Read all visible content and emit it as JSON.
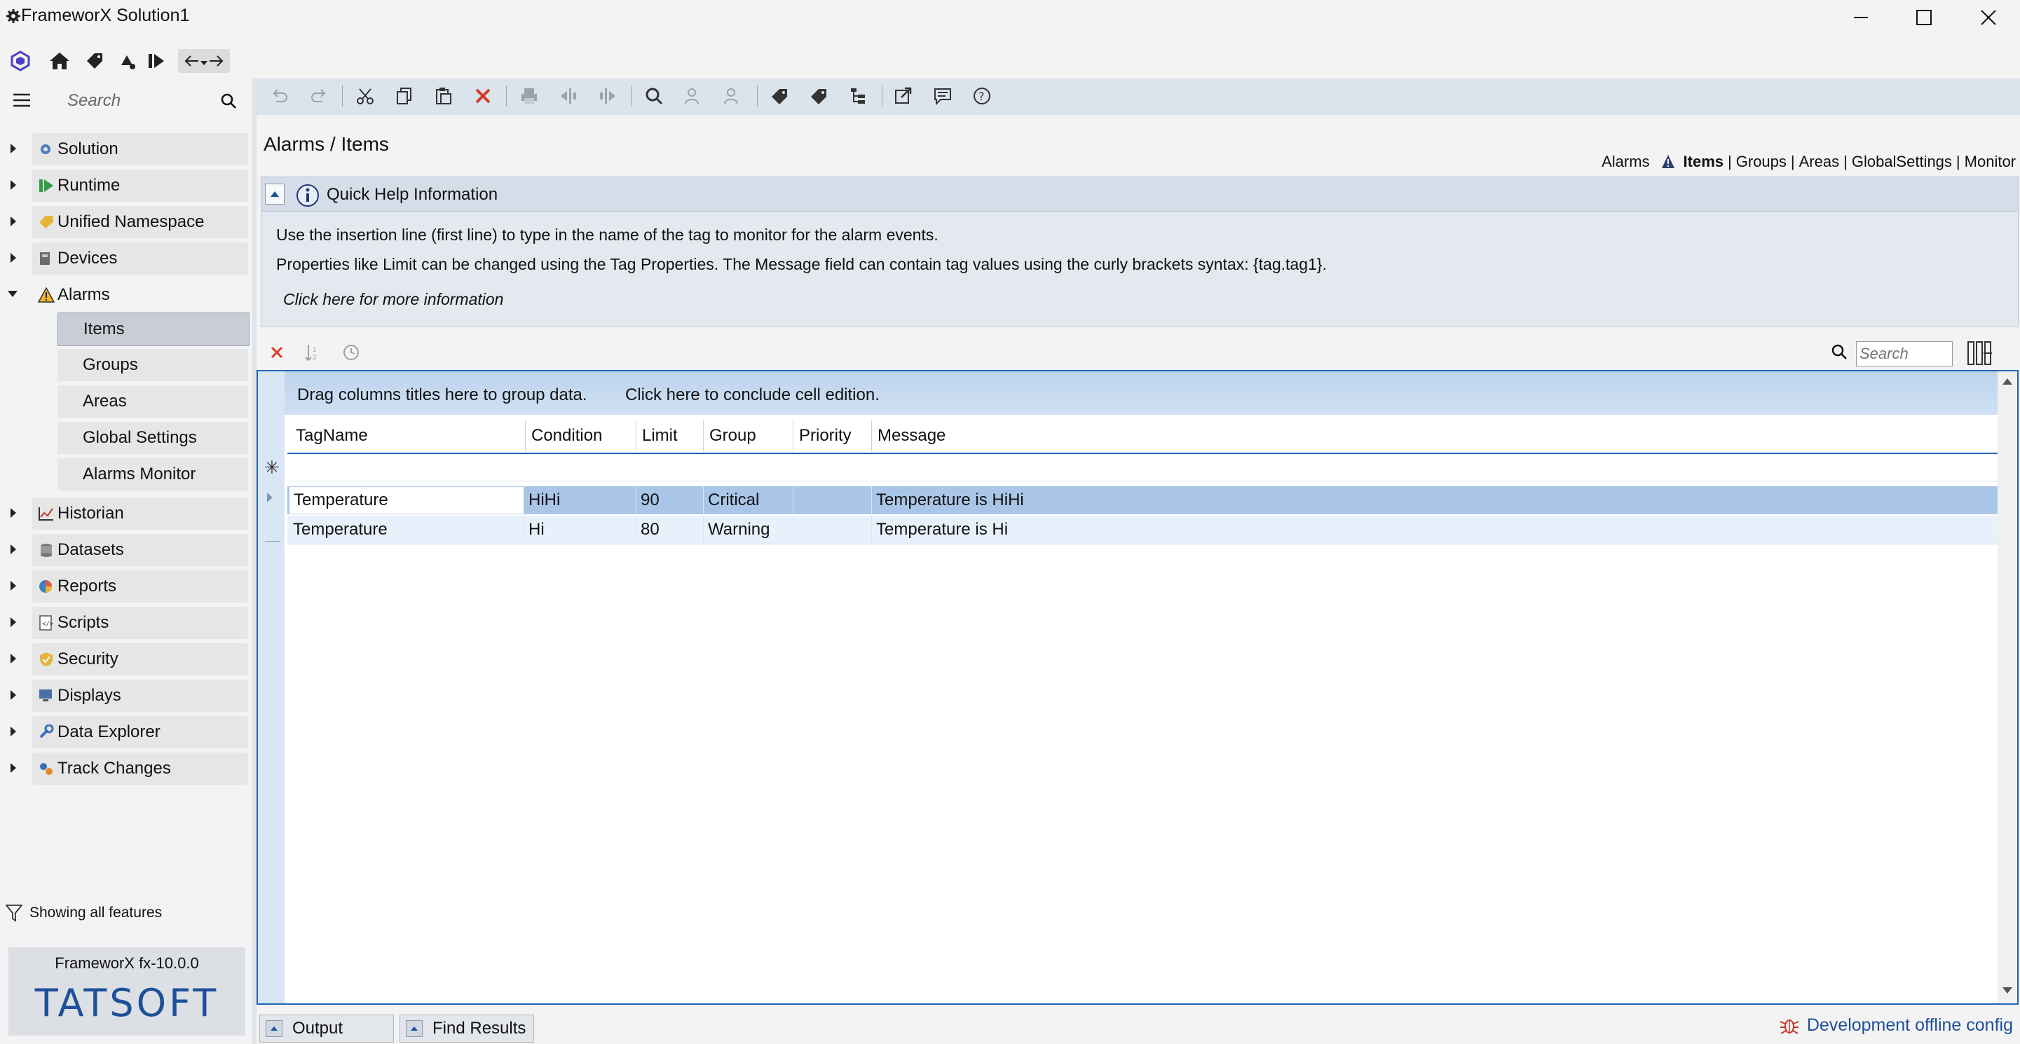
{
  "window": {
    "title": "FrameworX Solution1"
  },
  "sidebar": {
    "search_placeholder": "Search",
    "items": [
      {
        "label": "Solution"
      },
      {
        "label": "Runtime"
      },
      {
        "label": "Unified Namespace"
      },
      {
        "label": "Devices"
      },
      {
        "label": "Alarms"
      },
      {
        "label": "Historian"
      },
      {
        "label": "Datasets"
      },
      {
        "label": "Reports"
      },
      {
        "label": "Scripts"
      },
      {
        "label": "Security"
      },
      {
        "label": "Displays"
      },
      {
        "label": "Data Explorer"
      },
      {
        "label": "Track Changes"
      }
    ],
    "alarm_subitems": [
      {
        "label": "Items"
      },
      {
        "label": "Groups"
      },
      {
        "label": "Areas"
      },
      {
        "label": "Global Settings"
      },
      {
        "label": "Alarms Monitor"
      }
    ],
    "features_label": "Showing all features",
    "version": "FrameworX fx-10.0.0",
    "brand": "TATSOFT"
  },
  "page": {
    "title": "Alarms / Items",
    "crumbs": {
      "alarms": "Alarms",
      "items": "Items",
      "groups": "Groups",
      "areas": "Areas",
      "globalsettings": "GlobalSettings",
      "monitor": "Monitor",
      "sep": "|"
    }
  },
  "quick_help": {
    "title": "Quick Help Information",
    "line1": "Use the insertion line (first line) to type in the name of the tag to monitor for the alarm events.",
    "line2": "Properties like Limit can be changed using the Tag Properties. The Message field can contain tag values using the curly brackets syntax: {tag.tag1}.",
    "link": "Click here for more information"
  },
  "grid": {
    "search_placeholder": "Search",
    "group_hint": "Drag columns titles here to group data.",
    "conclude_hint": "Click here to conclude cell edition.",
    "columns": [
      "TagName",
      "Condition",
      "Limit",
      "Group",
      "Priority",
      "Message"
    ],
    "rows": [
      [
        "Temperature",
        "HiHi",
        "90",
        "Critical",
        "",
        "Temperature is HiHi"
      ],
      [
        "Temperature",
        "Hi",
        "80",
        "Warning",
        "",
        "Temperature is Hi"
      ]
    ]
  },
  "bottom": {
    "output_tab": "Output",
    "find_tab": "Find Results",
    "status": "Development offline config"
  },
  "colors": {
    "accent": "#1f66b5",
    "selected_row": "#a9c6e8",
    "row_alt": "#e8f1fb"
  }
}
